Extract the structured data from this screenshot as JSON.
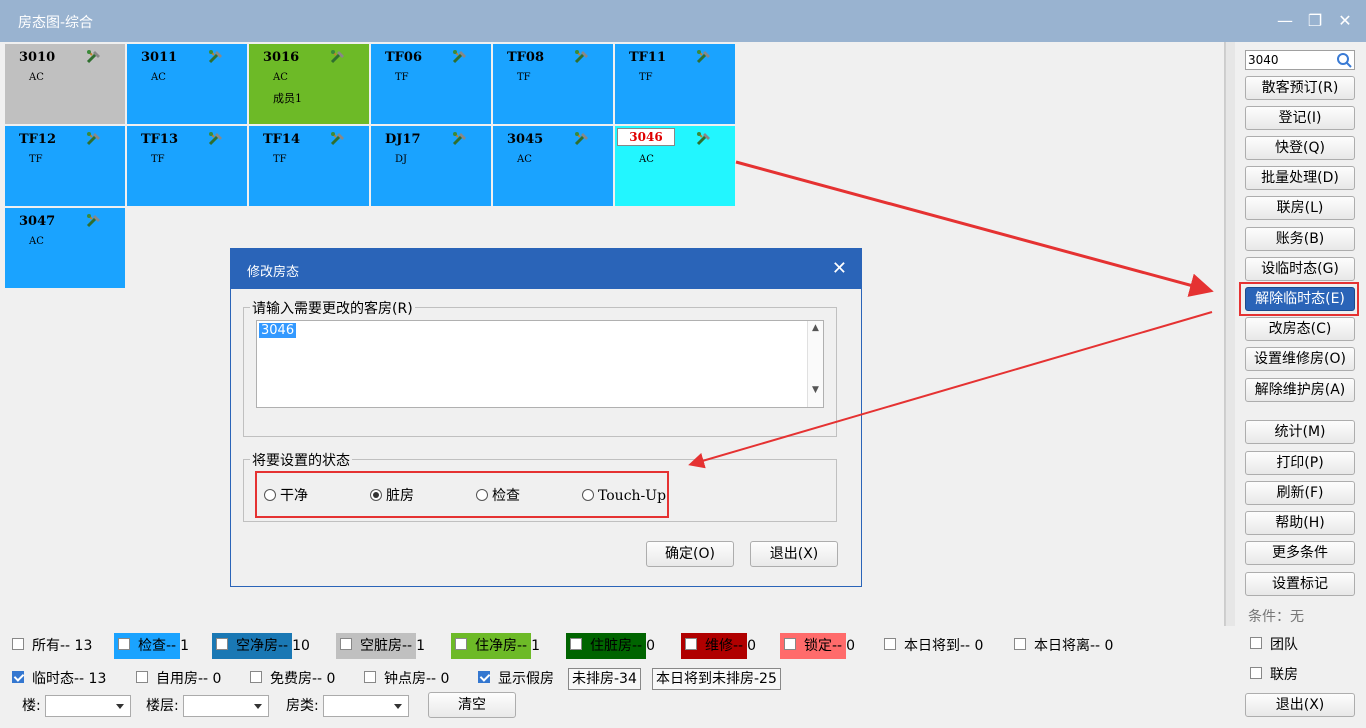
{
  "window": {
    "title": "房态图-综合",
    "minimize": "—",
    "restore": "❐",
    "close": "✕"
  },
  "rooms": [
    {
      "num": "3010",
      "type": "AC",
      "guest": "",
      "color": "#c0c0c0"
    },
    {
      "num": "3011",
      "type": "AC",
      "guest": "",
      "color": "#1aa3ff"
    },
    {
      "num": "3016",
      "type": "AC",
      "guest": "成员1",
      "color": "#6dba27"
    },
    {
      "num": "TF06",
      "type": "TF",
      "guest": "",
      "color": "#1aa3ff"
    },
    {
      "num": "TF08",
      "type": "TF",
      "guest": "",
      "color": "#1aa3ff"
    },
    {
      "num": "TF11",
      "type": "TF",
      "guest": "",
      "color": "#1aa3ff"
    },
    {
      "num": "TF12",
      "type": "TF",
      "guest": "",
      "color": "#1aa3ff"
    },
    {
      "num": "TF13",
      "type": "TF",
      "guest": "",
      "color": "#1aa3ff"
    },
    {
      "num": "TF14",
      "type": "TF",
      "guest": "",
      "color": "#1aa3ff"
    },
    {
      "num": "DJ17",
      "type": "DJ",
      "guest": "",
      "color": "#1aa3ff"
    },
    {
      "num": "3045",
      "type": "AC",
      "guest": "",
      "color": "#1aa3ff"
    },
    {
      "num": "3046",
      "type": "AC",
      "guest": "",
      "color": "#22f6ff"
    },
    {
      "num": "3047",
      "type": "AC",
      "guest": "",
      "color": "#1aa3ff"
    }
  ],
  "search": {
    "value": "3040"
  },
  "right_buttons": {
    "b0": "散客预订(R)",
    "b1": "登记(I)",
    "b2": "快登(Q)",
    "b3": "批量处理(D)",
    "b4": "联房(L)",
    "b5": "账务(B)",
    "b6": "设临时态(G)",
    "b7": "解除临时态(E)",
    "b8": "改房态(C)",
    "b9": "设置维修房(O)",
    "b10": "解除维护房(A)",
    "b11": "统计(M)",
    "b12": "打印(P)",
    "b13": "刷新(F)",
    "b14": "帮助(H)",
    "b15": "更多条件",
    "b16": "设置标记"
  },
  "conditions": {
    "label": "条件：无",
    "team": "团队",
    "linked": "联房",
    "exit": "退出(X)"
  },
  "legend": {
    "all": "所有-- 13",
    "inspect": "检查--",
    "inspect_n": "1",
    "vacant_clean": "空净房--",
    "vacant_clean_n": "10",
    "vacant_dirty": "空脏房--",
    "vacant_dirty_n": "1",
    "occ_clean": "住净房--",
    "occ_clean_n": "1",
    "occ_dirty": "住脏房--",
    "occ_dirty_n": "0",
    "repair": "维修--",
    "repair_n": "0",
    "locked": "锁定--",
    "locked_n": "0",
    "arriving": "本日将到-- 0",
    "leaving": "本日将离-- 0",
    "temp": "临时态-- 13",
    "self_use": "自用房-- 0",
    "free": "免费房-- 0",
    "hourly": "钟点房-- 0",
    "show_fake": "显示假房",
    "unassigned": "未排房-34",
    "arriving_unassigned": "本日将到未排房-25",
    "building": "楼:",
    "floor": "楼层:",
    "room_type": "房类:",
    "clear": "清空"
  },
  "dialog": {
    "title": "修改房态",
    "close": "✕",
    "rooms_label": "请输入需要更改的客房(R)",
    "rooms_value": "3046",
    "status_label": "将要设置的状态",
    "options": [
      "干净",
      "脏房",
      "检查",
      "Touch-Up"
    ],
    "selected": "脏房",
    "ok": "确定(O)",
    "cancel": "退出(X)"
  }
}
